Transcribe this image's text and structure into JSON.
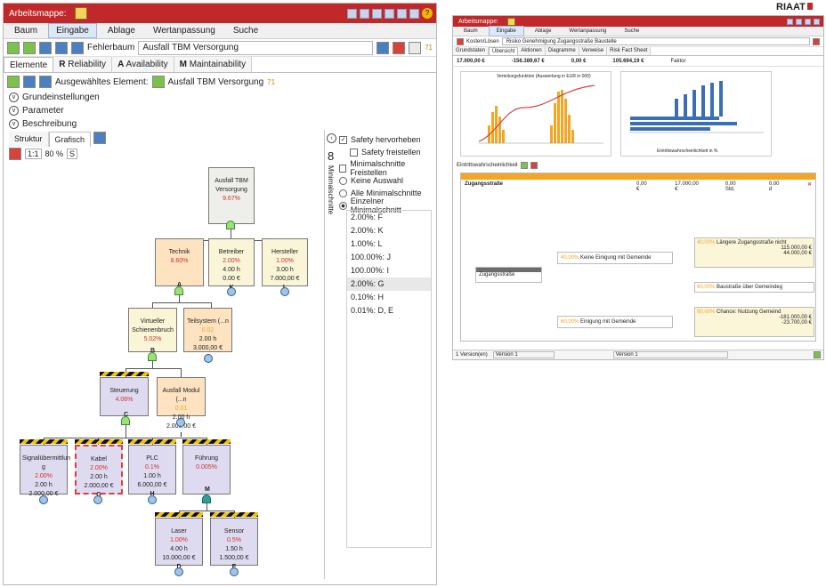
{
  "brand": {
    "logo": "RIAAT"
  },
  "left": {
    "title": "Arbeitsmappe:",
    "menu": [
      "Baum",
      "Eingabe",
      "Ablage",
      "Wertanpassung",
      "Suche"
    ],
    "fehlerbaum_label": "Fehlerbaum",
    "fehlerbaum_value": "Ausfall TBM Versorgung",
    "badge": "71",
    "tabs": [
      "Elemente",
      "Reliability",
      "Availability",
      "Maintainability"
    ],
    "tab_letters": [
      "R",
      "A",
      "M"
    ],
    "selected_label": "Ausgewähltes Element:",
    "selected_value": "Ausfall TBM Versorgung",
    "sections": [
      "Grundeinstellungen",
      "Parameter",
      "Beschreibung"
    ],
    "view_tabs": [
      "Struktur",
      "Grafisch"
    ],
    "zoom": {
      "ratio": "1:1",
      "value": "80 %",
      "btn": "S"
    },
    "nodes": [
      {
        "id": "top",
        "title": "Ausfall TBM Versorgung",
        "pct": "9.67%",
        "key": ""
      },
      {
        "id": "technik",
        "title": "Technik",
        "pct": "8.60%",
        "key": "A"
      },
      {
        "id": "betreiber",
        "title": "Betreiber",
        "pct": "2.00%",
        "line2": "4.00 h",
        "line3": "0.00 €",
        "key": "K"
      },
      {
        "id": "hersteller",
        "title": "Hersteller",
        "pct": "1.00%",
        "line2": "3.00 h",
        "line3": "7.000,00 €",
        "key": "L"
      },
      {
        "id": "virtueller",
        "title": "Virtueller Schienenbruch",
        "pct": "5.02%",
        "key": "B"
      },
      {
        "id": "teilsystem",
        "title": "Teilsystem (...n",
        "pct": "0.02",
        "line2": "2.00 h",
        "line3": "3.000,00 €",
        "key": "J"
      },
      {
        "id": "steuerung",
        "title": "Steuerung",
        "pct": "4.06%",
        "key": "C"
      },
      {
        "id": "ausfallmodul",
        "title": "Ausfall Modul (...n",
        "pct": "0.01",
        "line2": "2.00 h",
        "line3": "2.000,00 €",
        "key": "I"
      },
      {
        "id": "signal",
        "title": "Signalübermittlun g",
        "pct": "2.00%",
        "line2": "2.00 h",
        "line3": "2.000,00 €",
        "key": "F"
      },
      {
        "id": "kabel",
        "title": "Kabel",
        "pct": "2.00%",
        "line2": "2.00 h",
        "line3": "2.000,00 €",
        "key": "G"
      },
      {
        "id": "plc",
        "title": "PLC",
        "pct": "0.1%",
        "line2": "1.00 h",
        "line3": "6.000,00 €",
        "key": "H"
      },
      {
        "id": "fuehrung",
        "title": "Führung",
        "pct": "0.005%",
        "key": "M"
      },
      {
        "id": "laser",
        "title": "Laser",
        "pct": "1.00%",
        "line2": "4.00 h",
        "line3": "10.000,00 €",
        "key": "D"
      },
      {
        "id": "sensor",
        "title": "Sensor",
        "pct": "0.5%",
        "line2": "1.50 h",
        "line3": "1.500,00 €",
        "key": "E"
      }
    ],
    "panel": {
      "vertical_label": "Minimalschnitte",
      "count": "8",
      "safety_hervorheben": "Safety hervorheben",
      "safety_freistellen": "Safety freistellen",
      "min_freistellen": "Minimalschnitte Freistellen",
      "radios": [
        "Keine Auswahl",
        "Alle Minimalschnitte",
        "Einzelner Minimalschnitt"
      ],
      "cuts": [
        "2.00%: F",
        "2.00%: K",
        "1.00%: L",
        "100.00%: J",
        "100.00%: I",
        "2.00%: G",
        "0.10%: H",
        "0.01%: D, E"
      ]
    }
  },
  "right": {
    "title": "Arbeitsmappe:",
    "menu": [
      "Baum",
      "Eingabe",
      "Ablage",
      "Wertanpassung",
      "Suche"
    ],
    "toolbar_label": "Kosten/Lösen",
    "toolbar_value": "Risiko Genehmigung Zugangsstraße Baustelle",
    "tabs": [
      "Grundstaten",
      "Übersicht",
      "Aktionen",
      "Diagramme",
      "Verweise",
      "Risk Fact Sheet"
    ],
    "stats": [
      "17.000,00 €",
      "-156.389,67 €",
      "0,00 €",
      "105.694,19 €"
    ],
    "stat_label": "Faktor",
    "chart_title": "Verteilungsfunktion (Auswertung in EUR in 000)",
    "chart2_xlabel": "Eintrittswahrscheinlichkeit in %",
    "sensitivity_label": "Eintrittswahrscheinlichkeit",
    "tree_root": "Zugangsstraße",
    "tree_vals": [
      "0,00 €",
      "17.000,00 €",
      "0,00 Std.",
      "0,00 d"
    ],
    "ereignis_nodes": [
      {
        "pct": "40,00%",
        "label": "Keine Einigung mit Gemeinde"
      },
      {
        "pct": "60,00%",
        "label": "Einigung mit Gemeinde"
      },
      {
        "pct": "40,00%",
        "label": "Längere Zugangsstraße nicht"
      },
      {
        "pct": "60,00%",
        "label": "Baustraße über Gemeindeg"
      },
      {
        "pct": "90,00%",
        "label": "Chance: Nutzung Gemeind"
      }
    ],
    "vals": [
      "115.000,00 €",
      "44.000,00 €",
      "-181.000,00 €",
      "-23.700,00 €"
    ],
    "status_left": "1 Version(en)",
    "status_mid": "Version 1",
    "status_right": "Version 1"
  }
}
